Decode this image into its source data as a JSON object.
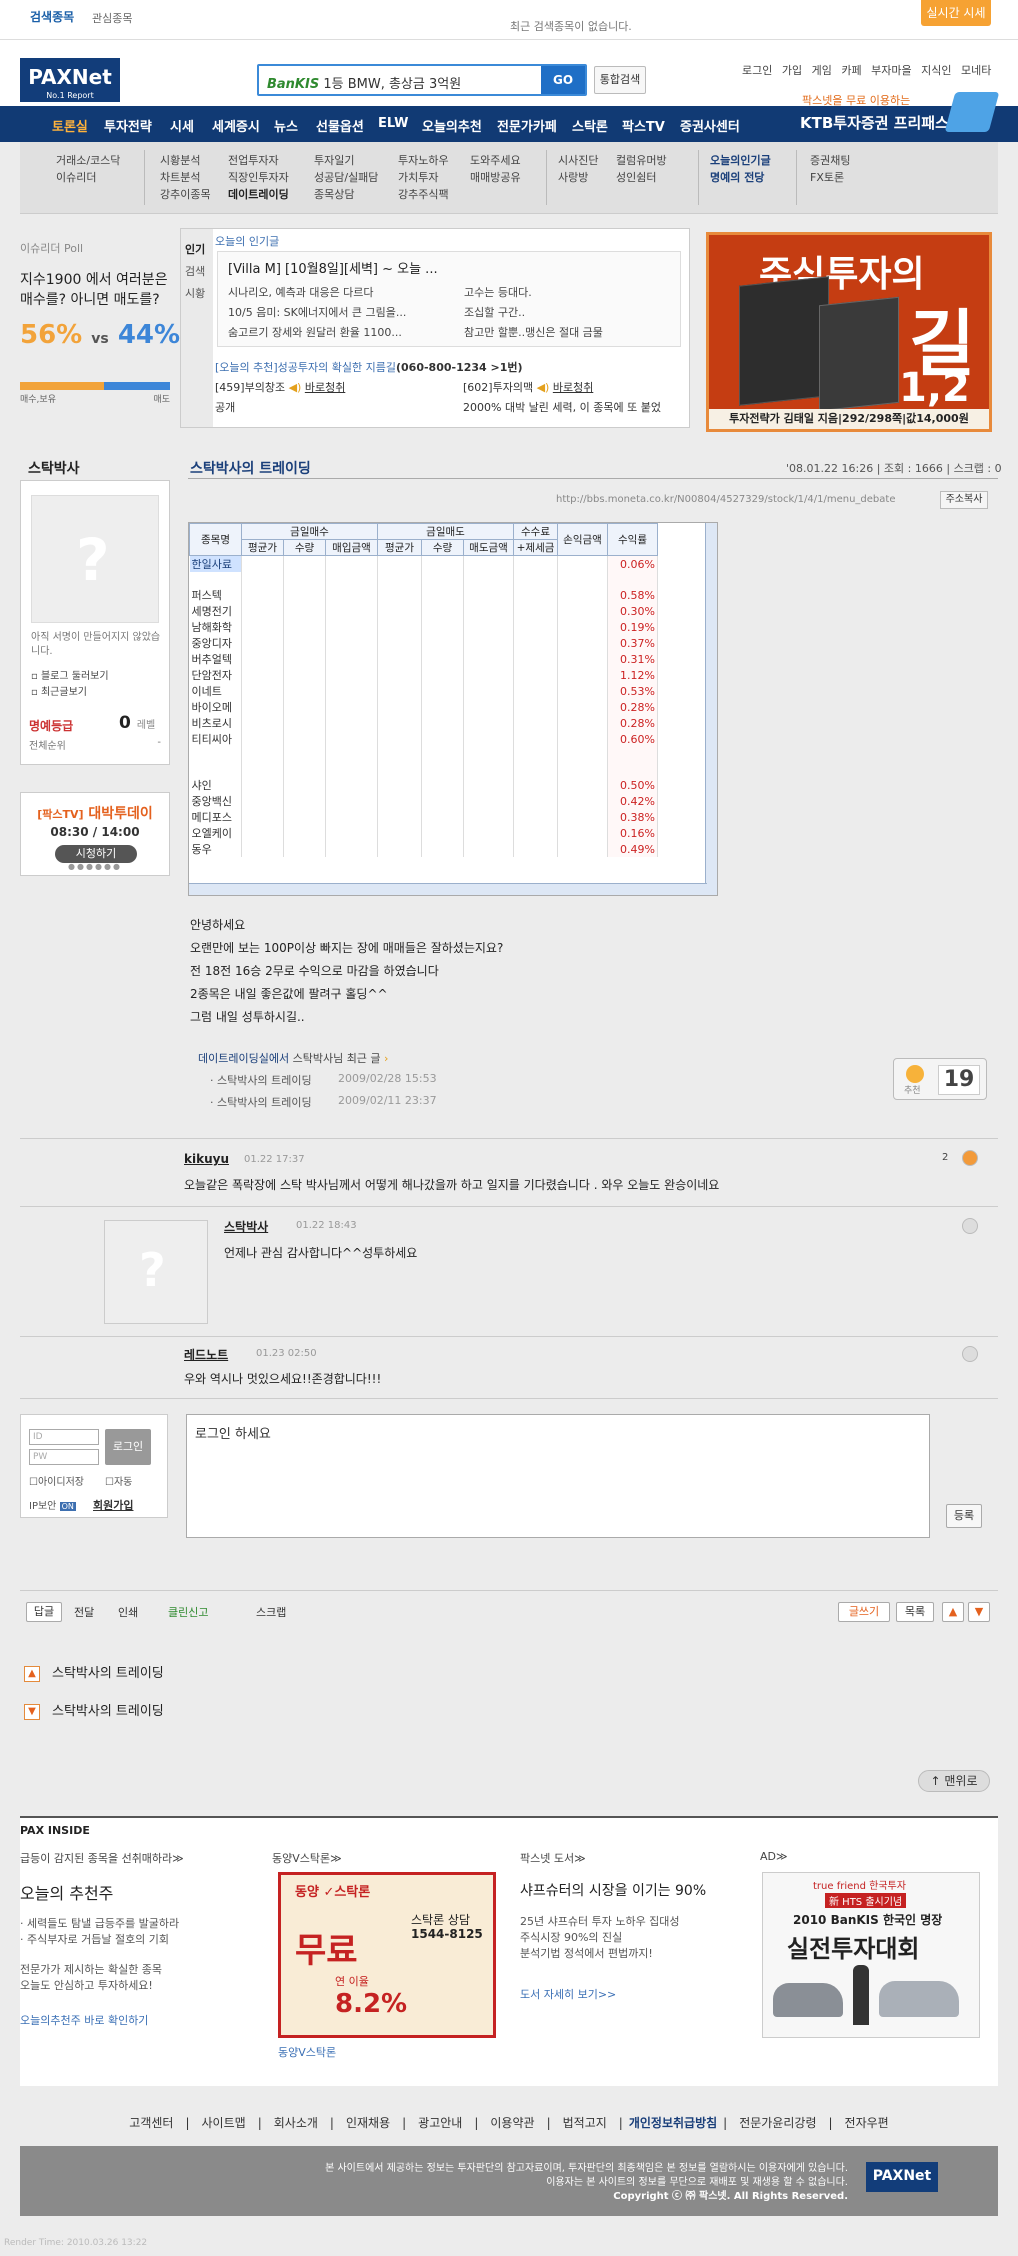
{
  "topbar": {
    "tab1": "검색종목",
    "tab2": "관심종목",
    "recent_msg": "최근 검색종목이 없습니다.",
    "realtime": "실시간 시세"
  },
  "logo": {
    "text": "PAXNet",
    "sub": "No.1 Report"
  },
  "search": {
    "brand": "BanKIS",
    "msg": "1등 BMW, 총상금 3억원",
    "go": "GO",
    "total": "통합검색"
  },
  "topnav": [
    "로그인",
    "가입",
    "게임",
    "카페",
    "부자마을",
    "지식인",
    "모네타"
  ],
  "promo": {
    "line1": "팍스넷을 무료 이용하는",
    "line2": "KTB투자증권 프리패스"
  },
  "mainnav": [
    "토론실",
    "투자전략",
    "시세",
    "세계증시",
    "뉴스",
    "선물옵션",
    "ELW",
    "오늘의추천",
    "전문가카페",
    "스탁론",
    "팍스TV",
    "증권사센터"
  ],
  "subnav": {
    "g1": [
      "거래소/코스닥",
      "이슈리더"
    ],
    "g2": [
      "시황분석",
      "차트분석",
      "강추이종목"
    ],
    "g3": [
      "전업투자자",
      "직장인투자자",
      "데이트레이딩"
    ],
    "g4": [
      "투자일기",
      "성공담/실패담",
      "종목상담"
    ],
    "g5": [
      "투자노하우",
      "가치투자",
      "강추주식팩"
    ],
    "g6": [
      "도와주세요",
      "매매방공유"
    ],
    "g7": [
      "시사진단",
      "사랑방"
    ],
    "g8": [
      "컬럼유머방",
      "성인쉼터"
    ],
    "g9": [
      "오늘의인기글",
      "명예의 전당"
    ],
    "g10": [
      "증권채팅",
      "FX토론"
    ]
  },
  "poll": {
    "title": "이슈리더 Poll",
    "question": "지수1900 에서 여러분은 매수를? 아니면 매도를?",
    "buy_pct": "56%",
    "vs": "vs",
    "sell_pct": "44%",
    "buy_label": "매수,보유",
    "sell_label": "매도",
    "buy_value": 56
  },
  "hot": {
    "tabs": [
      "인기",
      "검색",
      "시황"
    ],
    "title": "오늘의 인기글",
    "headline": "[Villa M] [10월8일][세벽] ~ 오늘 ...",
    "items": [
      "시나리오, 예측과 대응은 다르다",
      "고수는 등대다.",
      "10/5 음미: SK에너지에서 큰 그림을...",
      "조십할 구간..",
      "숨고르기 장세와 원달러 환율 1100...",
      "참고만 할뿐..맹신은 절대 금물"
    ],
    "rec_text": "[오늘의 추천]성공투자의 확실한 지름길",
    "rec_phone": "(060-800-1234 >1번)",
    "r1": "[459]부의창조",
    "r1b": "바로청취",
    "r2": "[602]투자의맥",
    "r2b": "바로청취",
    "r3": "공개",
    "r4": "2000% 대박 날린 세력, 이 종목에 또 붙었"
  },
  "ad1": {
    "title": "주식투자의",
    "big": "길",
    "num": "1,2",
    "foot": "투자전략가 김태일 지음|292/298쪽|값14,000원"
  },
  "profile": {
    "name": "스탁박사",
    "no_sig": "아직 서명이 만들어지지 않았습니다.",
    "link1": "블로그 둘러보기",
    "link2": "최근글보기",
    "rank_label": "명예등급",
    "rank_value": "0",
    "rank_unit": "레벨",
    "rank2_label": "전체순위",
    "rank2_value": "-"
  },
  "paxtv": {
    "tag": "[팍스TV]",
    "title": "대박투데이",
    "time": "08:30 / 14:00",
    "watch": "시청하기",
    "dots": "●●●●●●"
  },
  "article": {
    "title": "스탁박사의 트레이딩",
    "date": "'08.01.22 16:26",
    "views": "조회 : 1666",
    "scrap": "스크랩 : 0",
    "url": "http://bbs.moneta.co.kr/N00804/4527329/stock/1/4/1/menu_debate",
    "copy": "주소복사"
  },
  "table": {
    "h_name": "종목명",
    "h_buy": "금일매수",
    "h_sell": "금일매도",
    "h_fee": "수수료",
    "h_fee2": "+제세금",
    "h_pnl": "손익금액",
    "h_rate": "수익률",
    "sub": [
      "평균가",
      "수량",
      "매입금액",
      "평균가",
      "수량",
      "매도금액"
    ],
    "rows": [
      {
        "name": "한일사료",
        "rate": "0.06%"
      },
      {
        "name": "",
        "rate": ""
      },
      {
        "name": "퍼스텍",
        "rate": "0.58%"
      },
      {
        "name": "세명전기",
        "rate": "0.30%"
      },
      {
        "name": "남해화학",
        "rate": "0.19%"
      },
      {
        "name": "중앙디자",
        "rate": "0.37%"
      },
      {
        "name": "버추얼텍",
        "rate": "0.31%"
      },
      {
        "name": "단암전자",
        "rate": "1.12%"
      },
      {
        "name": "이네트",
        "rate": "0.53%"
      },
      {
        "name": "바이오메",
        "rate": "0.28%"
      },
      {
        "name": "비츠로시",
        "rate": "0.28%"
      },
      {
        "name": "티티씨아",
        "rate": "0.60%"
      },
      {
        "name": "",
        "rate": ""
      },
      {
        "name": "",
        "rate": ""
      },
      {
        "name": "샤인",
        "rate": "0.50%"
      },
      {
        "name": "중앙백신",
        "rate": "0.42%"
      },
      {
        "name": "메디포스",
        "rate": "0.38%"
      },
      {
        "name": "오엘케이",
        "rate": "0.16%"
      },
      {
        "name": "동우",
        "rate": "0.49%"
      }
    ]
  },
  "body": [
    "안녕하세요",
    "오랜만에 보는 100P이상 빠지는 장에 매매들은 잘하셨는지요?",
    "전 18전 16승 2무로 수익으로 마감을 하였습니다",
    "2종목은 내일 좋은값에 팔려구 홀딩^^",
    "그럼 내일 성투하시길.."
  ],
  "recent": {
    "prefix": "데이트레이딩실에서",
    "name": "스탁박사님 최근 글",
    "items": [
      {
        "title": "스탁박사의 트레이딩",
        "date": "2009/02/28 15:53"
      },
      {
        "title": "스탁박사의 트레이딩",
        "date": "2009/02/11 23:37"
      }
    ]
  },
  "recommend": {
    "label": "추천",
    "count": "19"
  },
  "comments": [
    {
      "nick": "kikuyu",
      "time": "01.22 17:37",
      "text": "오늘같은 폭락장에 스탁 박사님께서 어떻게 해나갔을까 하고 일지를 기다렸습니다 . 와우 오늘도 완승이네요",
      "badge": "2"
    },
    {
      "nick": "스탁박사",
      "time": "01.22 18:43",
      "text": "언제나 관심 감사합니다^^성투하세요"
    },
    {
      "nick": "레드노트",
      "time": "01.23 02:50",
      "text": "우와 역시나 멋있으세요!!존경합니다!!!"
    }
  ],
  "login": {
    "id_ph": "ID",
    "pw_ph": "PW",
    "btn": "로그인",
    "save_id": "아이디저장",
    "auto": "자동",
    "ip": "IP보안",
    "ip_state": "ON",
    "join": "회원가입"
  },
  "reply": {
    "placeholder": "로그인 하세요",
    "submit": "등록"
  },
  "actions": {
    "reply": "답글",
    "forward": "전달",
    "print": "인쇄",
    "report": "클린신고",
    "scrap": "스크랩",
    "write": "글쓰기",
    "list": "목록"
  },
  "prevnext": {
    "prev": "스탁박사의 트레이딩",
    "next": "스탁박사의 트레이딩"
  },
  "top_btn": "맨위로",
  "pax": {
    "header": "PAX INSIDE",
    "c1": {
      "hd": "급등이 감지된 종목을 선취매하라≫",
      "big": "오늘의 추천주",
      "l1": "· 세력들도 탐낼 급등주를 발굴하라",
      "l2": "· 주식부자로 거듭날 절호의 기회",
      "l3": "전문가가 제시하는 확실한 종목",
      "l4": "오늘도 안심하고 투자하세요!",
      "lk": "오늘의추천주 바로 확인하기"
    },
    "c2": {
      "hd": "동양V스탁론≫",
      "ad1": "동양",
      "ad2": "스탁론",
      "ad3": "스탁론 상담",
      "ad4": "1544-8125",
      "ad5": "무료",
      "ad6": "연 이율",
      "ad7": "8.2%",
      "lk": "동양V스탁론"
    },
    "c3": {
      "hd": "팍스넷 도서≫",
      "big": "샤프슈터의 시장을 이기는 90%",
      "l1": "25년 샤프슈터 투자 노하우 집대성",
      "l2": "주식시장 90%의 진실",
      "l3": "분석기법 정석에서 편법까지!",
      "lk": "도서 자세히 보기>>"
    },
    "c4": {
      "hd": "AD≫",
      "a1": "true friend 한국투자",
      "a2": "新 HTS 출시기념",
      "a3": "2010 BanKIS 한국인 명장",
      "a4": "실전투자대회"
    }
  },
  "footer": {
    "links": [
      "고객센터",
      "사이트맵",
      "회사소개",
      "인재채용",
      "광고안내",
      "이용약관",
      "법적고지",
      "개인정보취급방침",
      "전문가윤리강령",
      "전자우편"
    ],
    "l1": "본 사이트에서 제공하는 정보는 투자판단의 참고자료이며, 투자판단의 최종책임은 본 정보를 열람하시는 이용자에게 있습니다.",
    "l2": "이용자는 본 사이트의 정보를 무단으로 재배포 및 재생용 할 수 없습니다.",
    "l3": "Copyright ⓒ ㈜ 팍스넷. All Rights Reserved.",
    "logo": "PAXNet",
    "bottom": "Render Time: 2010.03.26 13:22"
  }
}
